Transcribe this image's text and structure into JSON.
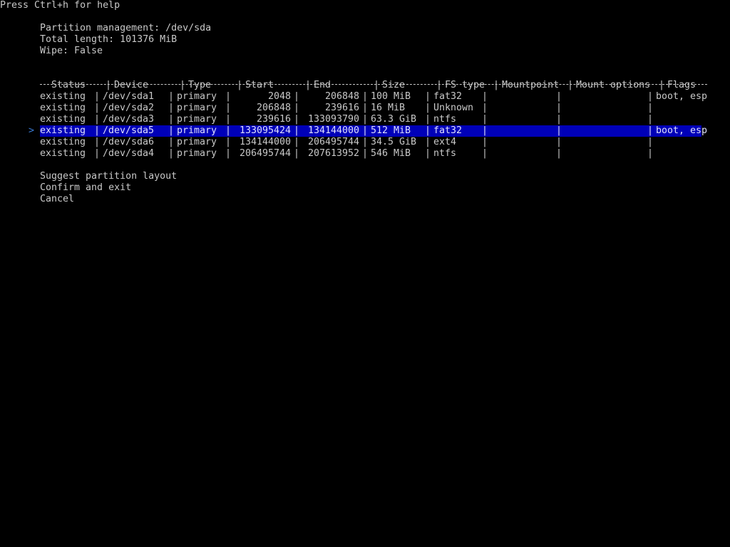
{
  "help_hint": "Press Ctrl+h for help",
  "info": {
    "title": "Partition management: /dev/sda",
    "length": "Total length: 101376 MiB",
    "wipe": "Wipe: False"
  },
  "table": {
    "headers": [
      "Status",
      "Device",
      "Type",
      "Start",
      "End",
      "Size",
      "FS type",
      "Mountpoint",
      "Mount options",
      "Flags"
    ],
    "separator_char": "-",
    "rows": [
      {
        "status": "existing",
        "device": "/dev/sda1",
        "type": "primary",
        "start": "2048",
        "end": "206848",
        "size": "100 MiB",
        "fs": "fat32",
        "mount": "",
        "mount_opts": "",
        "flags": "boot, esp"
      },
      {
        "status": "existing",
        "device": "/dev/sda2",
        "type": "primary",
        "start": "206848",
        "end": "239616",
        "size": "16 MiB",
        "fs": "Unknown",
        "mount": "",
        "mount_opts": "",
        "flags": ""
      },
      {
        "status": "existing",
        "device": "/dev/sda3",
        "type": "primary",
        "start": "239616",
        "end": "133093790",
        "size": "63.3 GiB",
        "fs": "ntfs",
        "mount": "",
        "mount_opts": "",
        "flags": ""
      },
      {
        "status": "existing",
        "device": "/dev/sda5",
        "type": "primary",
        "start": "133095424",
        "end": "134144000",
        "size": "512 MiB",
        "fs": "fat32",
        "mount": "",
        "mount_opts": "",
        "flags": "boot, esp"
      },
      {
        "status": "existing",
        "device": "/dev/sda6",
        "type": "primary",
        "start": "134144000",
        "end": "206495744",
        "size": "34.5 GiB",
        "fs": "ext4",
        "mount": "",
        "mount_opts": "",
        "flags": ""
      },
      {
        "status": "existing",
        "device": "/dev/sda4",
        "type": "primary",
        "start": "206495744",
        "end": "207613952",
        "size": "546 MiB",
        "fs": "ntfs",
        "mount": "",
        "mount_opts": "",
        "flags": ""
      }
    ],
    "selected_index": 3,
    "cursor_glyph": ">"
  },
  "menu": {
    "suggest": "Suggest partition layout",
    "confirm": "Confirm and exit",
    "cancel": "Cancel"
  },
  "colors": {
    "background": "#000000",
    "text": "#c8c8c8",
    "selection_bg": "#0000b8",
    "cursor": "#3a7bd5"
  }
}
